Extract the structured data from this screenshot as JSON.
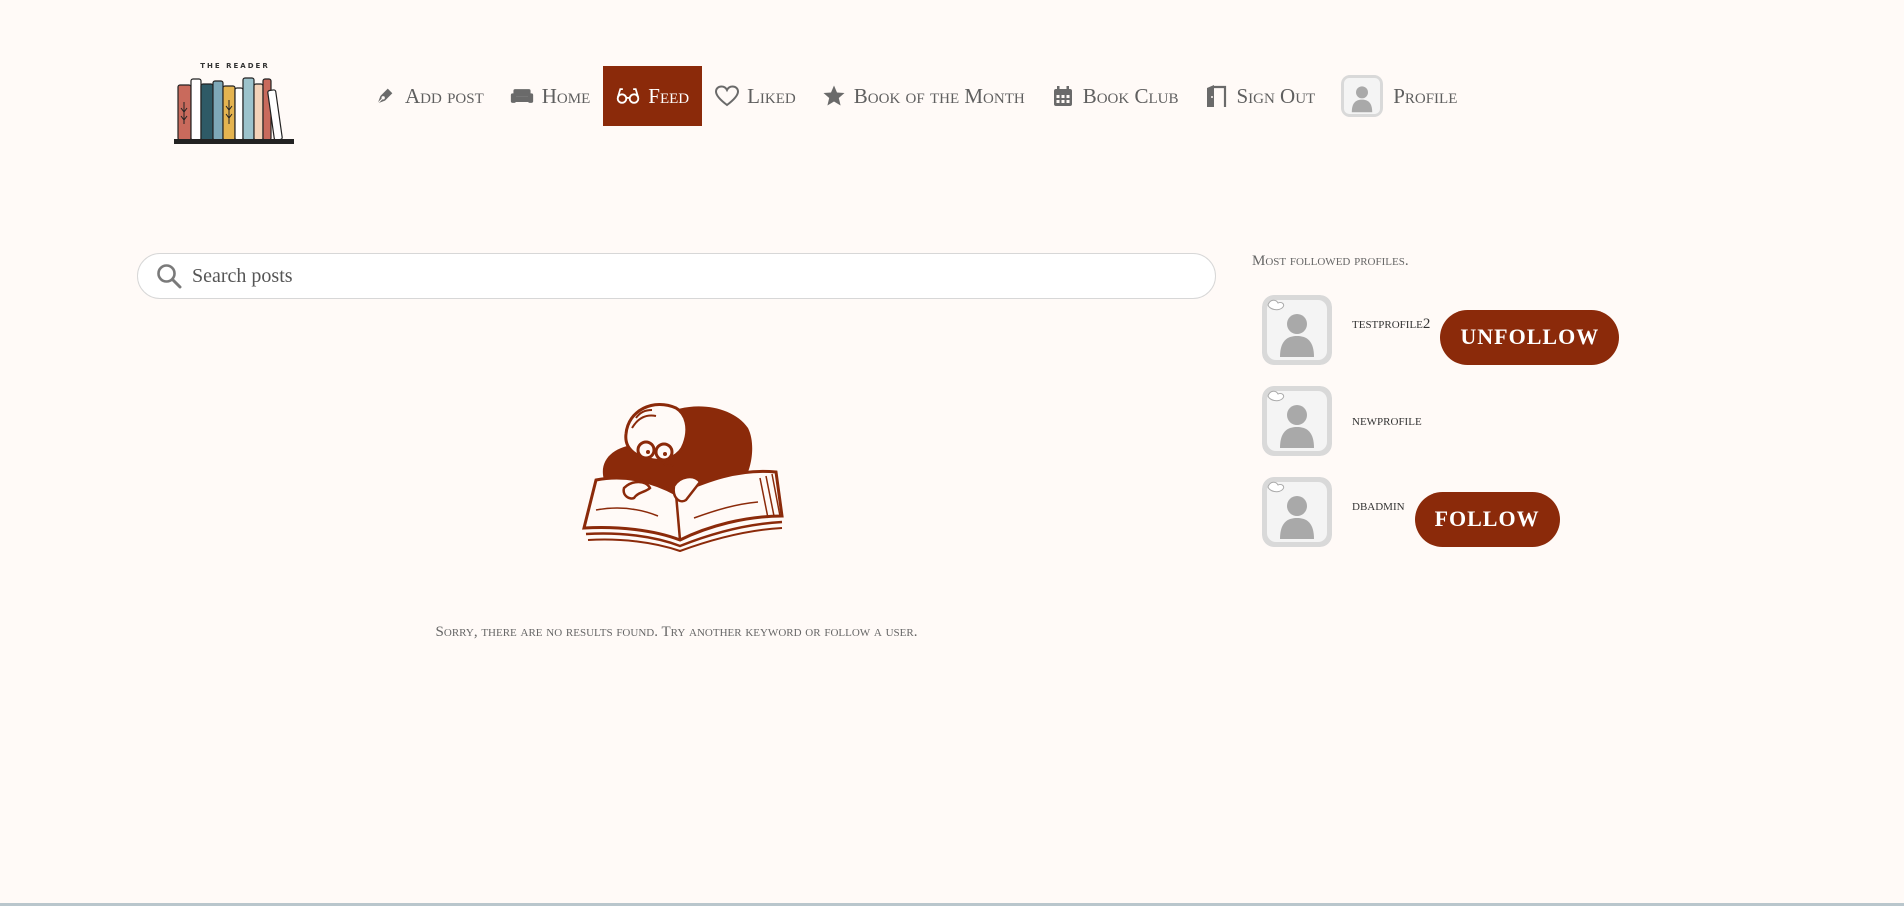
{
  "brand": {
    "logo_text": "THE READER"
  },
  "nav": {
    "items": [
      {
        "label": "Add post",
        "icon": "pen-icon"
      },
      {
        "label": "Home",
        "icon": "couch-icon"
      },
      {
        "label": "Feed",
        "icon": "glasses-icon",
        "active": true
      },
      {
        "label": "Liked",
        "icon": "heart-icon"
      },
      {
        "label": "Book of the Month",
        "icon": "star-icon"
      },
      {
        "label": "Book Club",
        "icon": "calendar-icon"
      },
      {
        "label": "Sign Out",
        "icon": "door-icon"
      },
      {
        "label": "Profile",
        "icon": "avatar"
      }
    ]
  },
  "search": {
    "placeholder": "Search posts",
    "value": ""
  },
  "empty_state": {
    "message": "Sorry, there are no results found. Try another keyword or follow a user."
  },
  "sidebar": {
    "title": "Most followed profiles.",
    "profiles": [
      {
        "name": "testprofile2",
        "button": "UNFOLLOW"
      },
      {
        "name": "newprofile",
        "button": ""
      },
      {
        "name": "dbadmin",
        "button": "FOLLOW"
      }
    ]
  },
  "colors": {
    "background": "#fffaf7",
    "accent": "#8b2a0a",
    "text": "#5f5f5f"
  }
}
